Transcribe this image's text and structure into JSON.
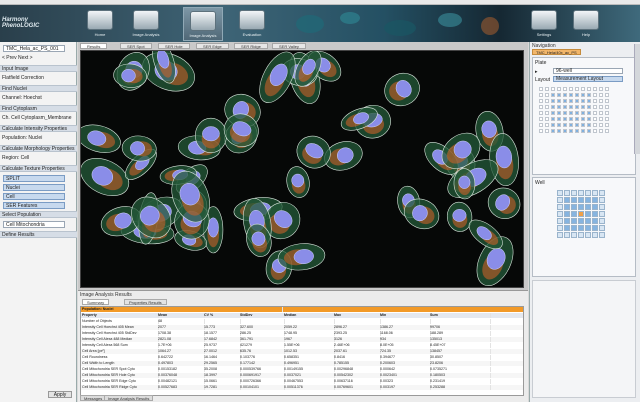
{
  "app": {
    "title": "Harmony",
    "brand": "Harmony  PhenoLOGIC"
  },
  "ribbon": {
    "buttons": [
      {
        "label": "Home"
      },
      {
        "label": "Image Analysis"
      },
      {
        "label": "Image Analysis"
      },
      {
        "label": "Evaluation"
      },
      {
        "label": "Settings"
      },
      {
        "label": "Help"
      }
    ]
  },
  "left_panel": {
    "rows": [
      {
        "type": "field",
        "text": "TMC_Hela_ac_PS_001"
      },
      {
        "type": "text",
        "text": "< Prev   Next >"
      },
      {
        "type": "head",
        "text": "Input Image"
      },
      {
        "type": "text",
        "text": "Flatfield Correction"
      },
      {
        "type": "head",
        "text": "Find Nuclei"
      },
      {
        "type": "text",
        "text": "Channel: Hoechst"
      },
      {
        "type": "head",
        "text": "Find Cytoplasm"
      },
      {
        "type": "text",
        "text": "Ch. Cell Cytoplasm_Membrane"
      },
      {
        "type": "head",
        "text": "Calculate Intensity Properties"
      },
      {
        "type": "text",
        "text": "Population: Nuclei"
      },
      {
        "type": "head",
        "text": "Calculate Morphology Properties"
      },
      {
        "type": "text",
        "text": "Region: Cell"
      },
      {
        "type": "head",
        "text": "Calculate Texture Properties"
      },
      {
        "type": "sel",
        "text": "SPLIT"
      },
      {
        "type": "sel",
        "text": "Nuclei"
      },
      {
        "type": "sel",
        "text": "Cell"
      },
      {
        "type": "sel",
        "text": "SER Features"
      },
      {
        "type": "head",
        "text": "Select Population"
      },
      {
        "type": "field",
        "text": "Cell Mitochondria"
      },
      {
        "type": "head",
        "text": "Define Results"
      }
    ],
    "apply_label": "Apply"
  },
  "viewer": {
    "tabs": [
      "Results",
      "SER Spot",
      "SER Hole",
      "SER Edge",
      "SER Ridge",
      "SER Valley"
    ]
  },
  "results": {
    "title": "Image Analysis Results",
    "tabs": [
      "Summary",
      "Properties Results"
    ],
    "columns": [
      "Property",
      "Mean",
      "CV %",
      "StdDev",
      "Median",
      "Max",
      "Min",
      "Sum"
    ],
    "population_label": "Population: Nuclei",
    "rows": [
      [
        "Number of Objects",
        "48",
        "",
        "",
        "",
        "",
        "",
        ""
      ],
      [
        "Intensity Cell Hoechst 405 Mean",
        "2077",
        "15.773",
        "327.600",
        "2059.22",
        "2896.27",
        "1386.27",
        "99706"
      ],
      [
        "Intensity Cell Hoechst 405 StdDev",
        "1708.38",
        "18.1577",
        "286.25",
        "1748.95",
        "2393.25",
        "1168.06",
        "188.289"
      ],
      [
        "Intensity Cell Alexa 488 Median",
        "2821.08",
        "17.6842",
        "361.791",
        "1967",
        "3126",
        "934",
        "135013"
      ],
      [
        "Intensity Cell Alexa 568 Sum",
        "1.7E+06",
        "25.9737",
        "421279",
        "1.55E+06",
        "2.46E+06",
        "8.0E+05",
        "8.45E+07"
      ],
      [
        "Cell Area [px²]",
        "1064.27",
        "27.0012",
        "635.76",
        "1012.53",
        "2037.61",
        "724.35",
        "138457"
      ],
      [
        "Cell Roundness",
        "0.642722",
        "16.1464",
        "0.103776",
        "0.658351",
        "0.8416",
        "0.394677",
        "30.8507"
      ],
      [
        "Cell Width to Length",
        "0.497803",
        "29.2565",
        "0.177142",
        "0.496951",
        "0.785155",
        "0.200603",
        "23.8206"
      ],
      [
        "Cell Mitochondria SER Spot Cyto",
        "0.00153182",
        "35.2008",
        "0.000539766",
        "0.00149155",
        "0.00296848",
        "0.000642",
        "0.0735271"
      ],
      [
        "Cell Mitochondria SER Hole Cyto",
        "0.00376048",
        "18.3997",
        "0.000691917",
        "0.0037021",
        "0.00542302",
        "0.0023401",
        "0.180503"
      ],
      [
        "Cell Mitochondria SER Edge Cyto",
        "0.00482121",
        "15.0661",
        "0.000726366",
        "0.00467553",
        "0.00637116",
        "0.00323",
        "0.231419"
      ],
      [
        "Cell Mitochondria SER Ridge Cyto",
        "0.00527683",
        "19.7281",
        "0.00104101",
        "0.00511376",
        "0.00769601",
        "0.003197",
        "0.253288"
      ]
    ],
    "bottom_tabs": [
      "Messages",
      "Image Analysis Results"
    ]
  },
  "navigation": {
    "title": "Navigation",
    "tab": "TMC_Hela/40x_ac_PS",
    "plate_label": "Plate",
    "plate_field": "96-well",
    "layout_label": "Layout",
    "layout_value": "Measurement Layout",
    "well_label": "Well"
  },
  "colors": {
    "accent": "#f29a28",
    "selection": "#7fb0df",
    "ribbon": "#3e6476"
  }
}
